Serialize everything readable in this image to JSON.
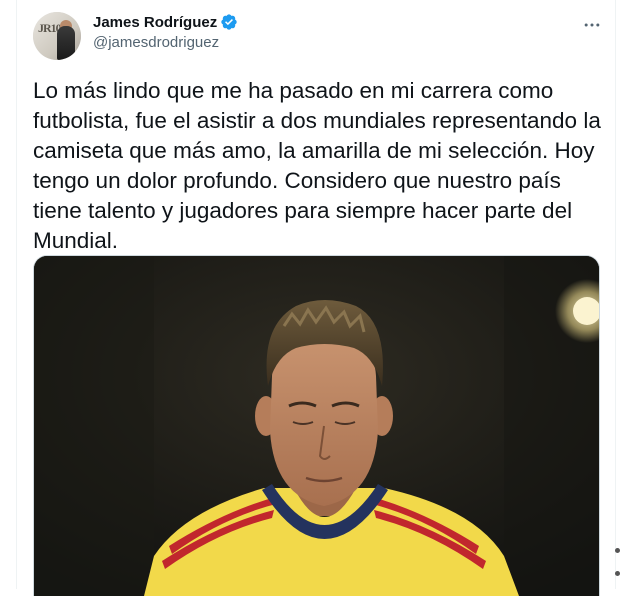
{
  "tweet": {
    "author_name": "James Rodríguez",
    "author_handle": "@jamesdrodriguez",
    "avatar_logo_text": "JR10",
    "text": "Lo más lindo que me ha pasado en mi carrera como futbolista, fue el asistir a dos mundiales representando la camiseta que más amo, la amarilla de mi selección. Hoy tengo un dolor profundo. Considero que nuestro país tiene talento y jugadores para siempre hacer parte del Mundial."
  },
  "icons": {
    "verified": "verified-badge-icon",
    "more": "more-horizontal-icon"
  },
  "colors": {
    "verified_blue": "#1d9bf0",
    "handle_gray": "#536471",
    "jersey_yellow": "#f2d94a",
    "jersey_red": "#c1272d",
    "collar_navy": "#24335e"
  }
}
